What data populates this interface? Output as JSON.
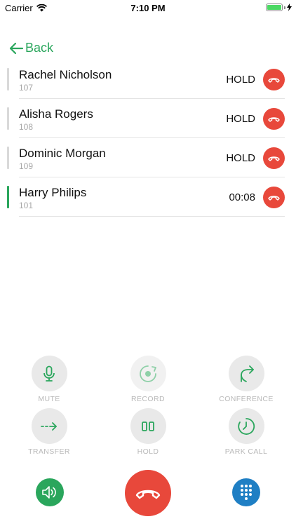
{
  "status_bar": {
    "carrier": "Carrier",
    "time": "7:10 PM"
  },
  "nav": {
    "back_label": "Back"
  },
  "calls": [
    {
      "name": "Rachel Nicholson",
      "ext": "107",
      "status": "HOLD"
    },
    {
      "name": "Alisha Rogers",
      "ext": "108",
      "status": "HOLD"
    },
    {
      "name": "Dominic Morgan",
      "ext": "109",
      "status": "HOLD"
    },
    {
      "name": "Harry Philips",
      "ext": "101",
      "status": "00:08"
    }
  ],
  "controls": {
    "mute": "MUTE",
    "record": "RECORD",
    "conference": "CONFERENCE",
    "transfer": "TRANSFER",
    "hold": "HOLD",
    "park_call": "PARK CALL"
  },
  "colors": {
    "accent": "#2aa65c",
    "danger": "#e8483b",
    "keypad": "#1f7fc4"
  }
}
